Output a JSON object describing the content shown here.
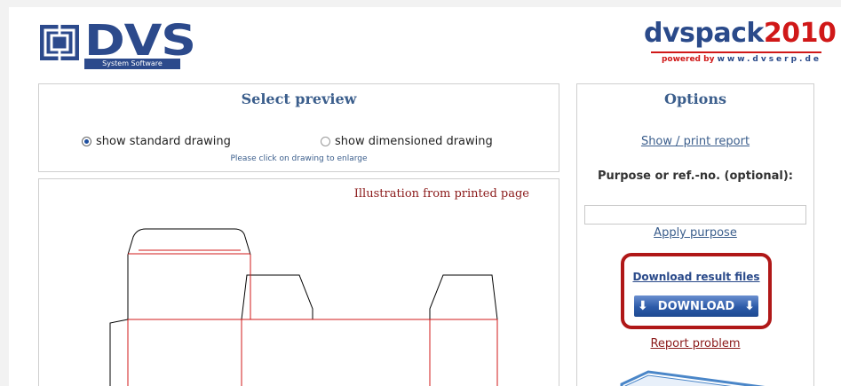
{
  "header": {
    "logo_word": "DVS",
    "logo_sub": "System Software",
    "brand_main": "dvspack",
    "brand_year": "2010",
    "brand_powered": "powered by",
    "brand_www": "www.dvserp.de"
  },
  "preview": {
    "title": "Select preview",
    "option_standard": "show standard drawing",
    "option_dimensioned": "show dimensioned drawing",
    "selected": "standard",
    "hint": "Please click on drawing to enlarge",
    "illustration_label": "Illustration from printed page"
  },
  "options": {
    "title": "Options",
    "show_print_report": "Show / print report",
    "purpose_label": "Purpose or ref.-no. (optional):",
    "purpose_value": "",
    "apply_purpose": "Apply purpose",
    "download_result_files": "Download result files",
    "download_button": "DOWNLOAD",
    "report_problem": "Report problem"
  },
  "colors": {
    "accent": "#3b5e8c",
    "highlight": "#b01818"
  }
}
